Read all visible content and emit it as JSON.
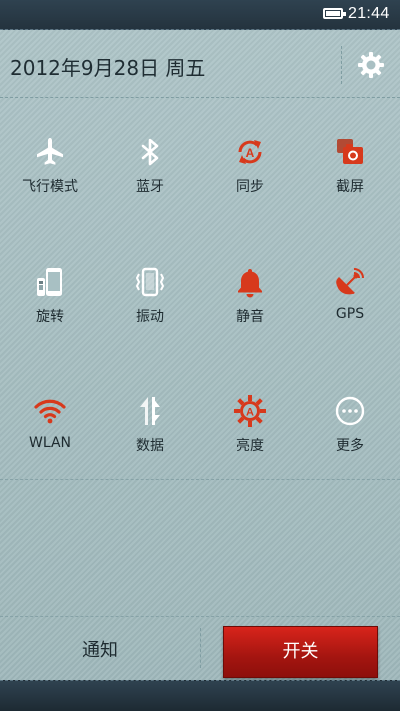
{
  "status_bar": {
    "time": "21:44",
    "battery_icon": "battery-full-icon"
  },
  "header": {
    "date": "2012年9月28日 周五",
    "settings_icon": "gear-icon"
  },
  "colors": {
    "accent_red": "#d7391c",
    "icon_white": "#ffffff",
    "switch_red": "#c41d16"
  },
  "toggles": [
    {
      "label": "飞行模式",
      "icon": "airplane-icon",
      "active": false
    },
    {
      "label": "蓝牙",
      "icon": "bluetooth-icon",
      "active": false
    },
    {
      "label": "同步",
      "icon": "sync-icon",
      "active": true
    },
    {
      "label": "截屏",
      "icon": "screenshot-icon",
      "active": true
    },
    {
      "label": "旋转",
      "icon": "rotate-icon",
      "active": false
    },
    {
      "label": "振动",
      "icon": "vibrate-icon",
      "active": false
    },
    {
      "label": "静音",
      "icon": "bell-icon",
      "active": true
    },
    {
      "label": "GPS",
      "icon": "gps-icon",
      "active": true
    },
    {
      "label": "WLAN",
      "icon": "wifi-icon",
      "active": true
    },
    {
      "label": "数据",
      "icon": "data-icon",
      "active": false
    },
    {
      "label": "亮度",
      "icon": "brightness-icon",
      "active": true
    },
    {
      "label": "更多",
      "icon": "more-icon",
      "active": false
    }
  ],
  "tabs": {
    "notifications": "通知",
    "switches": "开关"
  }
}
